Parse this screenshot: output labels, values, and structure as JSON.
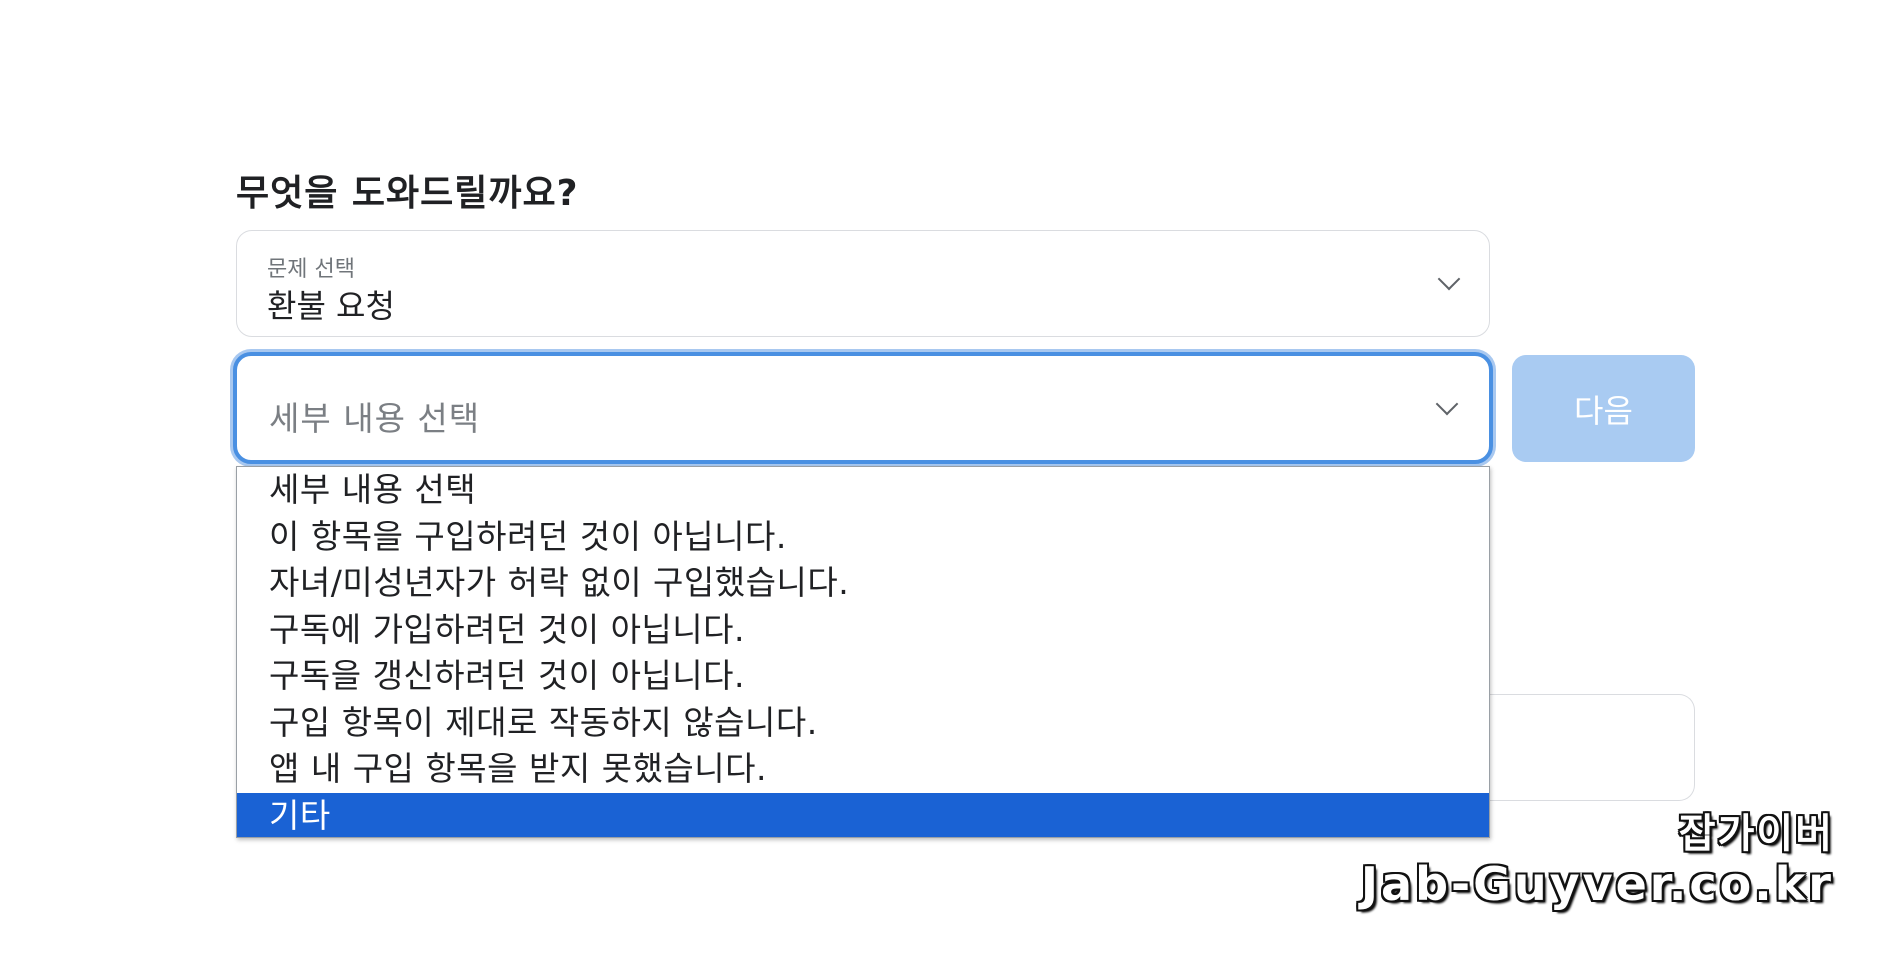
{
  "form": {
    "heading": "무엇을 도와드릴까요?",
    "problem_select": {
      "label": "문제 선택",
      "value": "환불 요청",
      "icon": "chevron-down-icon"
    },
    "detail_select": {
      "placeholder": "세부 내용 선택",
      "icon": "chevron-down-icon"
    },
    "next_button": {
      "label": "다음",
      "color": "#a9cbf2"
    }
  },
  "dropdown": {
    "options": [
      "세부 내용 선택",
      "이 항목을 구입하려던 것이 아닙니다.",
      "자녀/미성년자가 허락 없이 구입했습니다.",
      "구독에 가입하려던 것이 아닙니다.",
      "구독을 갱신하려던 것이 아닙니다.",
      "구입 항목이 제대로 작동하지 않습니다.",
      "앱 내 구입 항목을 받지 못했습니다.",
      "기타"
    ],
    "selected_index": 7,
    "highlight_color": "#1a62d4"
  },
  "watermark": {
    "line1": "잡가이버",
    "line2": "Jab-Guyver.co.kr"
  }
}
